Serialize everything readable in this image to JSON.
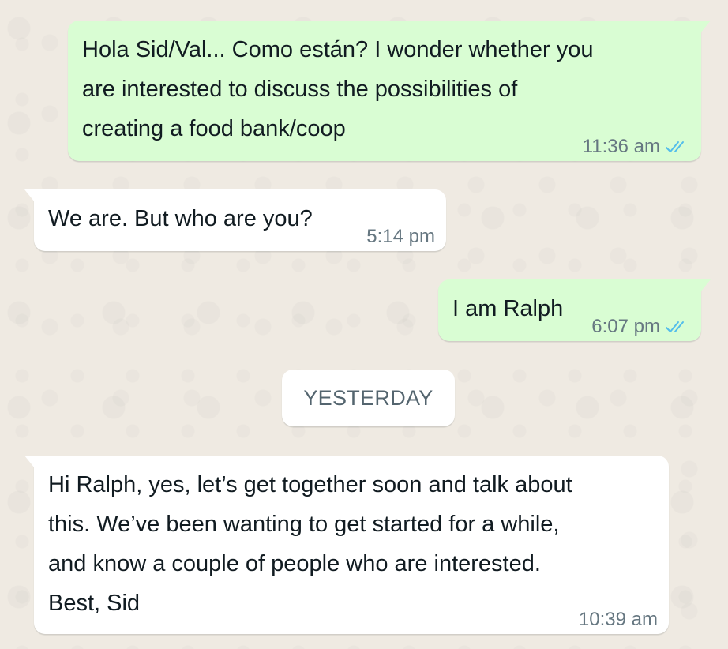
{
  "chat": {
    "messages": [
      {
        "direction": "outgoing",
        "text": "Hola Sid/Val... Como están? I wonder whether you\nare interested to discuss the possibilities of\ncreating a food bank/coop",
        "time": "11:36 am",
        "status_icon": "double-check-read-icon"
      },
      {
        "direction": "incoming",
        "text": "We are. But who are you?",
        "time": "5:14 pm"
      },
      {
        "direction": "outgoing",
        "text": "I am Ralph",
        "time": "6:07 pm",
        "status_icon": "double-check-read-icon"
      },
      {
        "direction": "incoming",
        "text": "Hi Ralph, yes, let’s get together soon and talk about\nthis. We’ve been wanting to get started for a while,\nand know a couple of people who are interested.\nBest, Sid",
        "time": "10:39 am"
      }
    ],
    "date_divider": "YESTERDAY"
  },
  "colors": {
    "background": "#efeae2",
    "outgoing_bubble": "#d9fdd3",
    "incoming_bubble": "#ffffff",
    "timestamp": "#667781",
    "read_check": "#53bdeb"
  }
}
